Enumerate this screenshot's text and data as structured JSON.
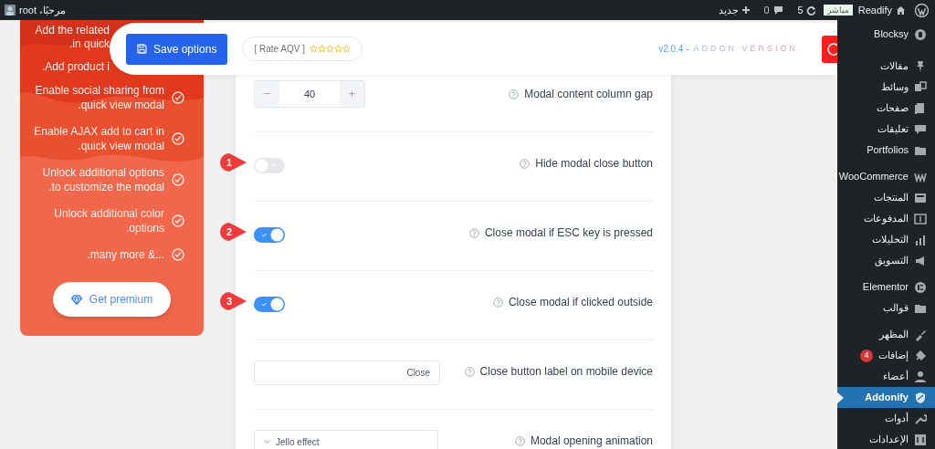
{
  "admin_bar": {
    "site": "Readify",
    "live_badge": "مباشر",
    "updates": "5",
    "comments": "0",
    "new": "جديد",
    "greeting": "مرحبًا، root"
  },
  "header": {
    "save_button": "Save options",
    "rate": "[ Rate AQV ]",
    "version": "v2.0.4 -",
    "version_label": "ADDON VERSION"
  },
  "promo": {
    "cut_lines": [
      "Add the related",
      ".in quick",
      ".Add product i"
    ],
    "features": [
      "Enable social sharing from quick view modal.",
      "Enable AJAX add to cart in quick view modal.",
      "Unlock additional options to customize the modal.",
      "Unlock additional color options.",
      "...& many more."
    ],
    "button": "Get premium"
  },
  "settings": [
    {
      "kind": "stepper",
      "label": "Modal content column gap",
      "value": "40",
      "minus": "−",
      "plus": "+"
    },
    {
      "kind": "toggle",
      "label": "Hide modal close button",
      "on": false,
      "callout": "1"
    },
    {
      "kind": "toggle",
      "label": "Close modal if ESC key is pressed",
      "on": true,
      "callout": "2"
    },
    {
      "kind": "toggle",
      "label": "Close modal if clicked outside",
      "on": true,
      "callout": "3"
    },
    {
      "kind": "text",
      "label": "Close button label on mobile device",
      "value": "Close"
    },
    {
      "kind": "select",
      "label": "Modal opening animation",
      "value": "Jello effect"
    }
  ],
  "sidebar": {
    "groups": [
      [
        {
          "label": "Blocksy",
          "selected": false
        }
      ],
      [
        {
          "label": "مقالات",
          "selected": false
        },
        {
          "label": "وسائط",
          "selected": false
        },
        {
          "label": "صفحات",
          "selected": false
        },
        {
          "label": "تعليقات",
          "selected": false
        },
        {
          "label": "Portfolios",
          "selected": false
        }
      ],
      [
        {
          "label": "WooCommerce",
          "selected": false
        },
        {
          "label": "المنتجات",
          "selected": false
        },
        {
          "label": "المدفوعات",
          "selected": false
        },
        {
          "label": "التحليلات",
          "selected": false
        },
        {
          "label": "التسويق",
          "selected": false
        }
      ],
      [
        {
          "label": "Elementor",
          "selected": false
        },
        {
          "label": "قوالب",
          "selected": false
        }
      ],
      [
        {
          "label": "المظهر",
          "selected": false
        },
        {
          "label": "إضافات",
          "selected": false,
          "badge": "4"
        },
        {
          "label": "أعضاء",
          "selected": false
        },
        {
          "label": "Addonify",
          "selected": true
        },
        {
          "label": "أدوات",
          "selected": false
        },
        {
          "label": "الإعدادات",
          "selected": false
        }
      ]
    ]
  }
}
